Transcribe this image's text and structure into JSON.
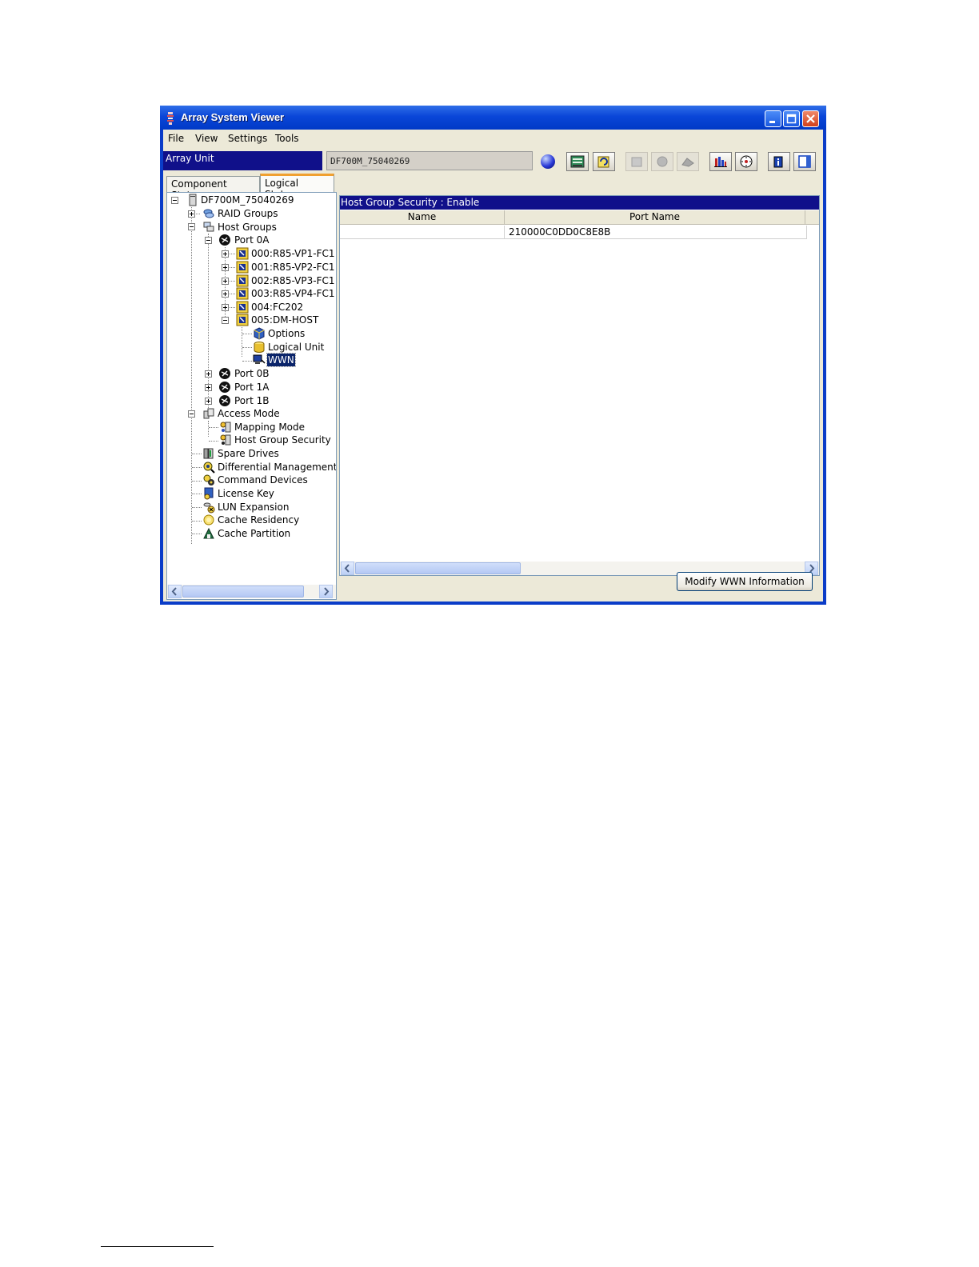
{
  "window": {
    "title": "Array System Viewer",
    "menu": [
      "File",
      "View",
      "Settings",
      "Tools"
    ]
  },
  "toolbar": {
    "array_unit_label": "Array Unit",
    "array_name": "DF700M_75040269",
    "icons": [
      "status-indicator-icon",
      "array-icon",
      "refresh-icon",
      "disabled-tool-icon",
      "disabled-tool-icon",
      "disabled-tool-icon",
      "performance-chart-icon",
      "settings-dial-icon",
      "info-icon",
      "panel-icon"
    ]
  },
  "tabs": {
    "component_status": "Component Status",
    "logical_status": "Logical Status"
  },
  "tree": {
    "root": "DF700M_75040269",
    "raid_groups": "RAID Groups",
    "host_groups": "Host Groups",
    "port_0a": "Port 0A",
    "hg_000": "000:R85-VP1-FC1",
    "hg_001": "001:R85-VP2-FC1",
    "hg_002": "002:R85-VP3-FC1",
    "hg_003": "003:R85-VP4-FC1",
    "hg_004": "004:FC202",
    "hg_005": "005:DM-HOST",
    "options": "Options",
    "logical_unit": "Logical Unit",
    "wwn": "WWN",
    "port_0b": "Port 0B",
    "port_1a": "Port 1A",
    "port_1b": "Port 1B",
    "access_mode": "Access Mode",
    "mapping_mode": "Mapping Mode",
    "host_group_security": "Host Group Security",
    "spare_drives": "Spare Drives",
    "differential_management": "Differential Management",
    "command_devices": "Command Devices",
    "license_key": "License Key",
    "lun_expansion": "LUN Expansion",
    "cache_residency": "Cache Residency",
    "cache_partition": "Cache Partition"
  },
  "content": {
    "header": "Host Group Security : Enable",
    "columns": [
      "Name",
      "Port Name"
    ],
    "rows": [
      {
        "name": "",
        "port_name": "210000C0DD0C8E8B"
      }
    ],
    "modify_button": "Modify WWN Information"
  }
}
